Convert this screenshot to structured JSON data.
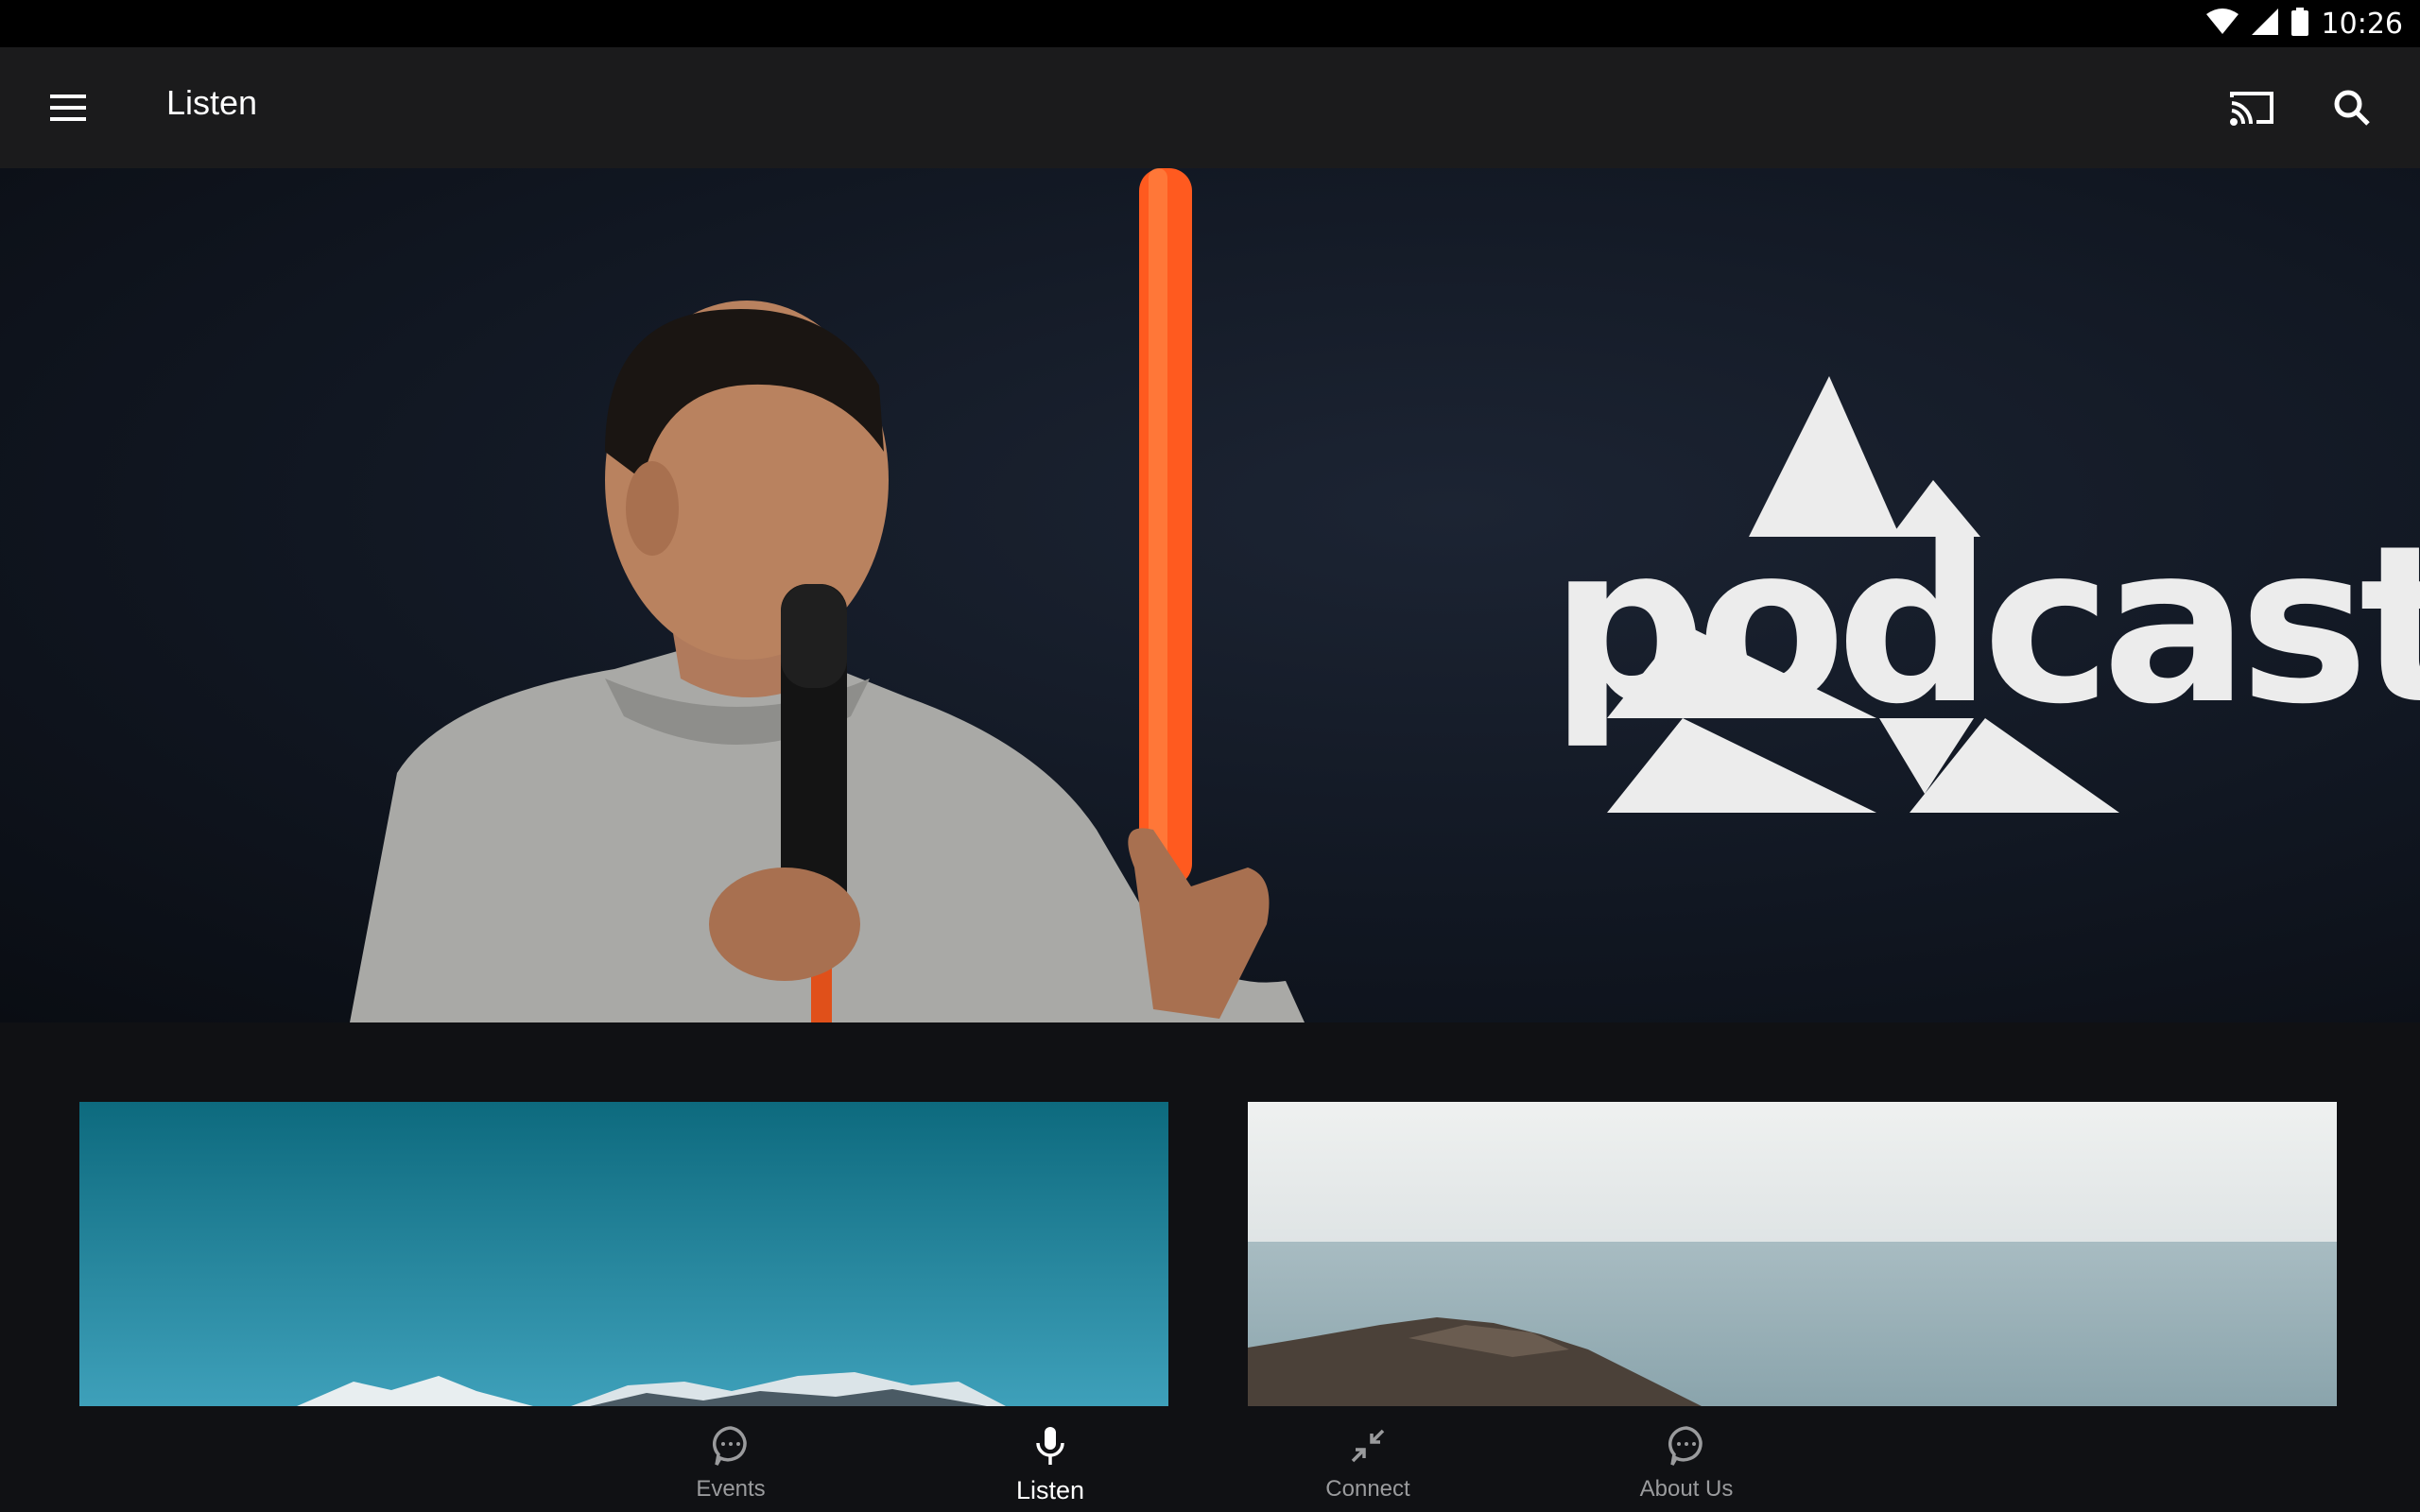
{
  "status_bar": {
    "time": "10:26",
    "icons": [
      "wifi-icon",
      "cellular-signal-icon",
      "battery-icon"
    ]
  },
  "app_bar": {
    "title": "Listen",
    "menu_icon": "hamburger-menu-icon",
    "actions": [
      {
        "name": "cast",
        "icon": "cast-icon"
      },
      {
        "name": "search",
        "icon": "search-icon"
      }
    ]
  },
  "hero": {
    "logo_text": "podcast",
    "accent_color": "#ff5a1f"
  },
  "cards": [
    {
      "name": "mountain-image-card",
      "scene": "mountains"
    },
    {
      "name": "ocean-image-card",
      "scene": "ocean"
    }
  ],
  "bottom_nav": {
    "items": [
      {
        "label": "Events",
        "icon": "chat-bubble-icon",
        "active": false
      },
      {
        "label": "Listen",
        "icon": "microphone-icon",
        "active": true
      },
      {
        "label": "Connect",
        "icon": "arrows-inward-icon",
        "active": false
      },
      {
        "label": "About Us",
        "icon": "chat-bubble-icon",
        "active": false
      }
    ]
  },
  "colors": {
    "status_bar": "#000000",
    "app_bar": "#1b1b1c",
    "background": "#101114",
    "nav_inactive": "#9a9b9d",
    "nav_active": "#ffffff"
  }
}
